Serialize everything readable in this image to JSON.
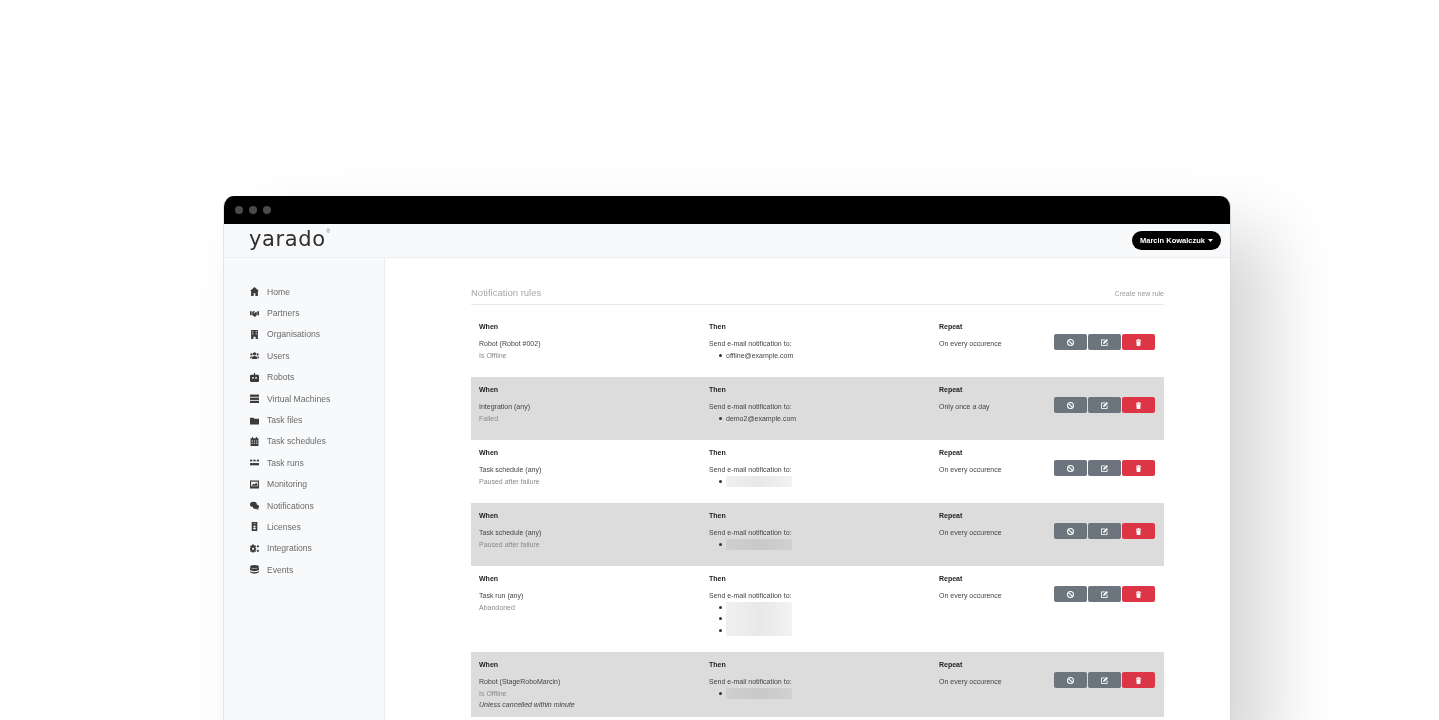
{
  "header": {
    "logo": "yarado",
    "logo_mark": "®",
    "user_menu": {
      "label": "Marcin Kowalczuk"
    }
  },
  "sidebar": {
    "items": [
      {
        "label": "Home"
      },
      {
        "label": "Partners"
      },
      {
        "label": "Organisations"
      },
      {
        "label": "Users"
      },
      {
        "label": "Robots"
      },
      {
        "label": "Virtual Machines"
      },
      {
        "label": "Task files"
      },
      {
        "label": "Task schedules"
      },
      {
        "label": "Task runs"
      },
      {
        "label": "Monitoring"
      },
      {
        "label": "Notifications"
      },
      {
        "label": "Licenses"
      },
      {
        "label": "Integrations"
      },
      {
        "label": "Events"
      }
    ]
  },
  "page": {
    "title": "Notification rules",
    "action": "Create new rule"
  },
  "rules": [
    {
      "when_heading": "When",
      "subject": "Robot (Robot #002)",
      "condition": "Is Offline",
      "then_heading": "Then",
      "action": "Send e-mail notification to:",
      "recipients": [
        {
          "kind": "email",
          "address": "offline@example.com"
        }
      ],
      "repeat_heading": "Repeat",
      "repeat": "On every occurence"
    },
    {
      "when_heading": "When",
      "subject": "Integration (any)",
      "condition": "Failed",
      "then_heading": "Then",
      "action": "Send e-mail notification to:",
      "recipients": [
        {
          "kind": "email",
          "address": "demo2@example.com"
        }
      ],
      "repeat_heading": "Repeat",
      "repeat": "Only once a day"
    },
    {
      "when_heading": "When",
      "subject": "Task schedule (any)",
      "condition": "Paused after failure",
      "then_heading": "Then",
      "action": "Send e-mail notification to:",
      "recipients": [
        {
          "kind": "redacted"
        }
      ],
      "repeat_heading": "Repeat",
      "repeat": "On every occurence"
    },
    {
      "when_heading": "When",
      "subject": "Task schedule (any)",
      "condition": "Paused after failure",
      "then_heading": "Then",
      "action": "Send e-mail notification to:",
      "recipients": [
        {
          "kind": "redacted"
        }
      ],
      "repeat_heading": "Repeat",
      "repeat": "On every occurence"
    },
    {
      "when_heading": "When",
      "subject": "Task run (any)",
      "condition": "Abandoned",
      "then_heading": "Then",
      "action": "Send e-mail notification to:",
      "recipients": [
        {
          "kind": "redacted"
        },
        {
          "kind": "redacted"
        },
        {
          "kind": "redacted"
        }
      ],
      "repeat_heading": "Repeat",
      "repeat": "On every occurence"
    },
    {
      "when_heading": "When",
      "subject": "Robot (StageRoboMarcin)",
      "condition": "Is Offline",
      "note": "Unless cancelled within minute",
      "then_heading": "Then",
      "action": "Send e-mail notification to:",
      "recipients": [
        {
          "kind": "redacted"
        }
      ],
      "repeat_heading": "Repeat",
      "repeat": "On every occurence"
    }
  ]
}
